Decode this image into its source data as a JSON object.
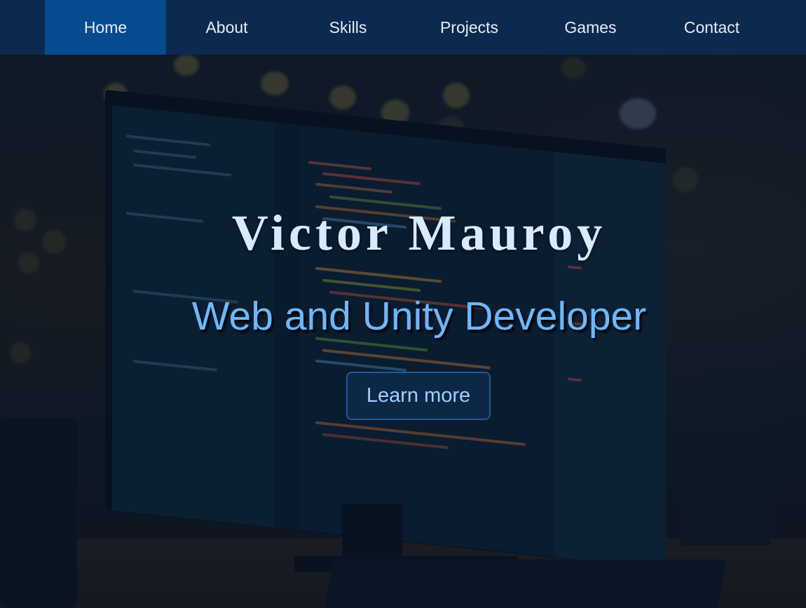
{
  "nav": {
    "items": [
      {
        "label": "Home",
        "active": true
      },
      {
        "label": "About",
        "active": false
      },
      {
        "label": "Skills",
        "active": false
      },
      {
        "label": "Projects",
        "active": false
      },
      {
        "label": "Games",
        "active": false
      },
      {
        "label": "Contact",
        "active": false
      }
    ]
  },
  "hero": {
    "title": "Victor Mauroy",
    "subtitle": "Web and Unity Developer",
    "cta_label": "Learn more",
    "background_image": "developer-desk-monitor-photo"
  },
  "colors": {
    "nav_bg": "#0c2a4f",
    "nav_active_bg": "#064b8f",
    "title": "#d7ebff",
    "subtitle": "#6cb8ff",
    "button_bg": "#0d2747",
    "button_border": "#1e5a98",
    "button_text": "#9fd0ff"
  }
}
